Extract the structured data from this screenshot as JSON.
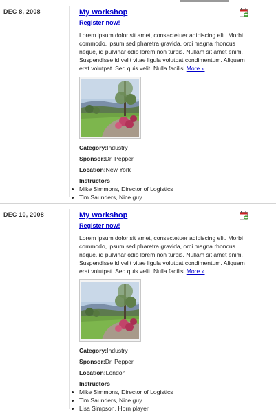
{
  "events": [
    {
      "date": "DEC 8, 2008",
      "title": "My workshop",
      "register_label": "Register now!",
      "description": "Lorem ipsum dolor sit amet, consectetuer adipiscing elit. Morbi commodo, ipsum sed pharetra gravida, orci magna rhoncus neque, id pulvinar odio lorem non turpis. Nullam sit amet enim. Suspendisse id velit vitae ligula volutpat condimentum. Aliquam erat volutpat. Sed quis velit. Nulla facilisi.",
      "more_label": "More »",
      "category_label": "Category:",
      "category": "Industry",
      "sponsor_label": "Sponsor:",
      "sponsor": "Dr. Pepper",
      "location_label": "Location:",
      "location": "New York",
      "instructors_heading": "Instructors",
      "instructors": [
        "Mike Simmons, Director of Logistics",
        "Tim Saunders, Nice guy"
      ]
    },
    {
      "date": "DEC 10, 2008",
      "title": "My workshop",
      "register_label": "Register now!",
      "description": "Lorem ipsum dolor sit amet, consectetuer adipiscing elit. Morbi commodo, ipsum sed pharetra gravida, orci magna rhoncus neque, id pulvinar odio lorem non turpis. Nullam sit amet enim. Suspendisse id velit vitae ligula volutpat condimentum. Aliquam erat volutpat. Sed quis velit. Nulla facilisi.",
      "more_label": "More »",
      "category_label": "Category:",
      "category": "Industry",
      "sponsor_label": "Sponsor:",
      "sponsor": "Dr. Pepper",
      "location_label": "Location:",
      "location": "London",
      "instructors_heading": "Instructors",
      "instructors": [
        "Mike Simmons, Director of Logistics",
        "Tim Saunders, Nice guy",
        "Lisa Simpson, Horn player"
      ]
    }
  ],
  "colors": {
    "link": "#0000cc",
    "calendar_icon_green": "#3a9a2a",
    "calendar_icon_red": "#cc2222"
  },
  "icons": {
    "calendar": "calendar-add-icon",
    "photo": "landscape-photo"
  }
}
